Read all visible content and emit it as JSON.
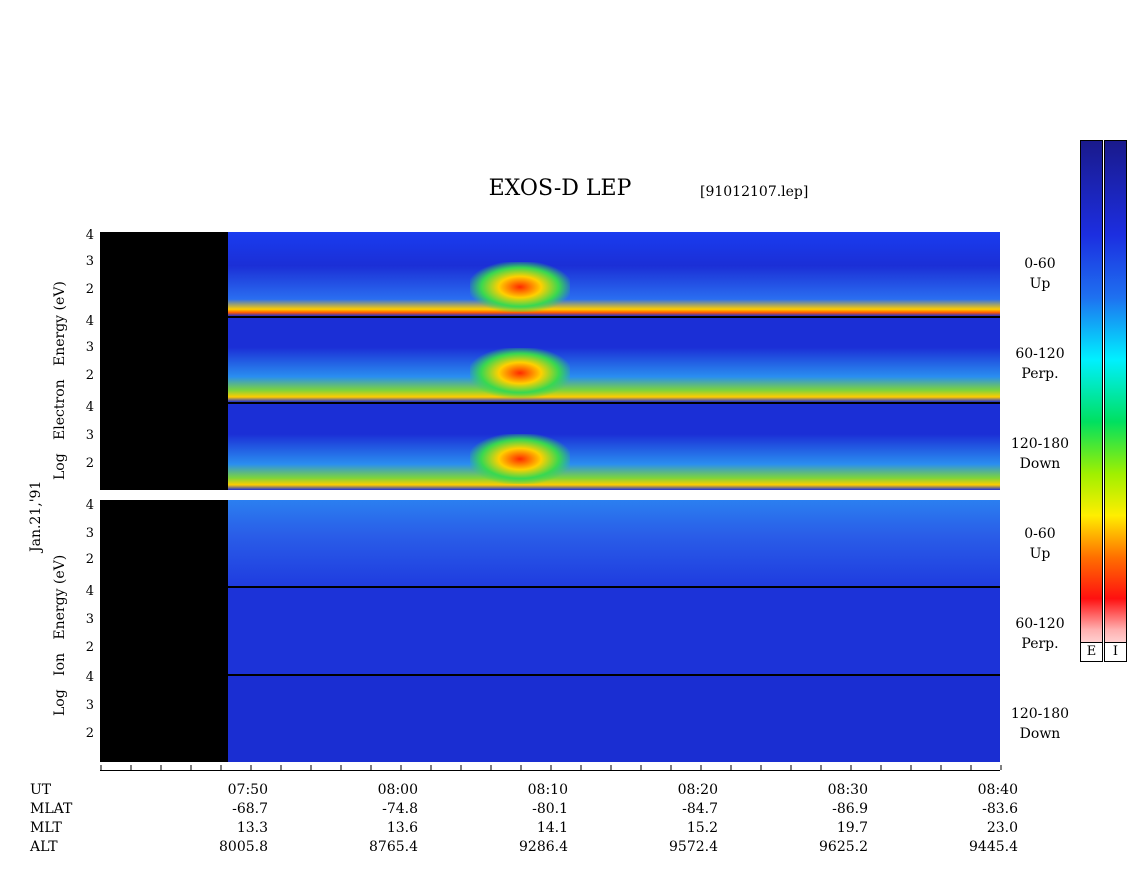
{
  "title": "EXOS-D LEP",
  "file": "[91012107.lep]",
  "date_label": "Jan.21,'91",
  "electron_ylabel": [
    "Log",
    "Electron",
    "Energy",
    "(eV)"
  ],
  "ion_ylabel": [
    "Log",
    "Ion",
    "Energy",
    "(eV)"
  ],
  "panel_ticks": [
    "4",
    "3",
    "2"
  ],
  "pitch_labels": [
    {
      "range": "0-60",
      "dir": "Up"
    },
    {
      "range": "60-120",
      "dir": "Perp."
    },
    {
      "range": "120-180",
      "dir": "Down"
    }
  ],
  "colorbars": {
    "left_label": "E",
    "right_label": "I"
  },
  "colors": {
    "background": "#1b2fd6",
    "no_data": "#000000"
  },
  "chart_data": {
    "type": "heatmap",
    "title": "EXOS-D LEP",
    "x_axis": "UT",
    "y_axis": "Log Energy (eV)",
    "ylim": [
      1,
      4
    ],
    "panels": [
      "Electron 0-60 Up",
      "Electron 60-120 Perp.",
      "Electron 120-180 Down",
      "Ion 0-60 Up",
      "Ion 60-120 Perp.",
      "Ion 120-180 Down"
    ],
    "row_labels": [
      "UT",
      "MLAT",
      "MLT",
      "ALT"
    ],
    "columns": [
      {
        "UT": "07:50",
        "MLAT": "-68.7",
        "MLT": "13.3",
        "ALT": "8005.8"
      },
      {
        "UT": "08:00",
        "MLAT": "-74.8",
        "MLT": "13.6",
        "ALT": "8765.4"
      },
      {
        "UT": "08:10",
        "MLAT": "-80.1",
        "MLT": "14.1",
        "ALT": "9286.4"
      },
      {
        "UT": "08:20",
        "MLAT": "-84.7",
        "MLT": "15.2",
        "ALT": "9572.4"
      },
      {
        "UT": "08:30",
        "MLAT": "-86.9",
        "MLT": "19.7",
        "ALT": "9625.2"
      },
      {
        "UT": "08:40",
        "MLAT": "-83.6",
        "MLT": "23.0",
        "ALT": "9445.4"
      }
    ]
  }
}
